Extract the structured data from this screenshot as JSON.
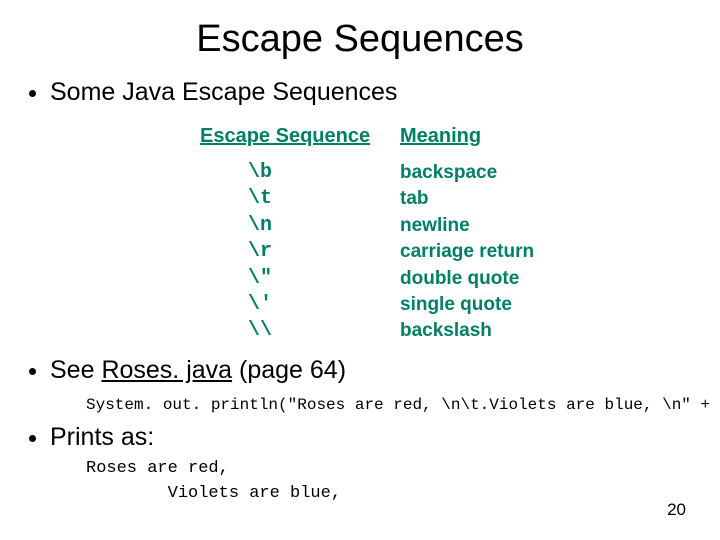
{
  "title": "Escape Sequences",
  "bullets": {
    "intro": "Some Java Escape Sequences",
    "see_prefix": "See ",
    "see_link": "Roses. java",
    "see_suffix": " (page 64)",
    "prints_as": "Prints as:"
  },
  "table": {
    "hdr_seq": "Escape Sequence",
    "hdr_mean": "Meaning",
    "rows": [
      {
        "seq": "\\b",
        "mean": "backspace"
      },
      {
        "seq": "\\t",
        "mean": "tab"
      },
      {
        "seq": "\\n",
        "mean": "newline"
      },
      {
        "seq": "\\r",
        "mean": "carriage return"
      },
      {
        "seq": "\\\"",
        "mean": "double quote"
      },
      {
        "seq": "\\'",
        "mean": "single quote"
      },
      {
        "seq": "\\\\",
        "mean": "backslash"
      }
    ]
  },
  "code": "System. out. println(\"Roses are red, \\n\\t.Violets are blue, \\n\" +",
  "output_line1": "Roses are red,",
  "output_line2": "        Violets are blue,",
  "page_number": "20"
}
